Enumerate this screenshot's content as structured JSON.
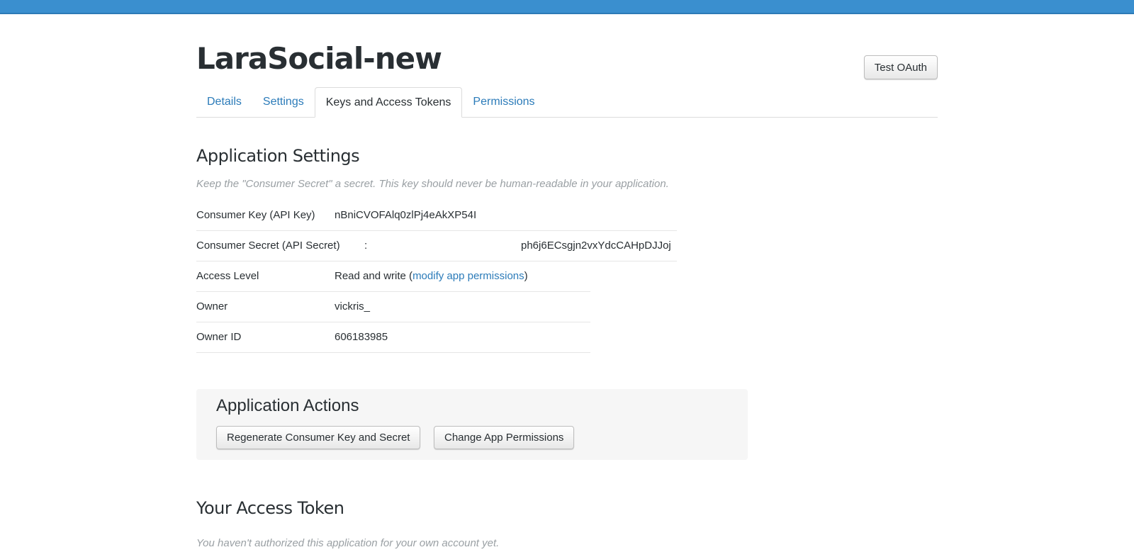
{
  "app": {
    "title": "LaraSocial-new",
    "test_oauth_label": "Test OAuth"
  },
  "tabs": [
    {
      "label": "Details",
      "active": false
    },
    {
      "label": "Settings",
      "active": false
    },
    {
      "label": "Keys and Access Tokens",
      "active": true
    },
    {
      "label": "Permissions",
      "active": false
    }
  ],
  "application_settings": {
    "title": "Application Settings",
    "note": "Keep the \"Consumer Secret\" a secret. This key should never be human-readable in your application.",
    "rows": {
      "consumer_key": {
        "label": "Consumer Key (API Key)",
        "value": "nBniCVOFAlq0zlPj4eAkXP54I"
      },
      "consumer_secret": {
        "label": "Consumer Secret (API Secret)",
        "value_start": ":",
        "value_end": "ph6j6ECsgjn2vxYdcCAHpDJJoj"
      },
      "access_level": {
        "label": "Access Level",
        "value_prefix": "Read and write (",
        "link": "modify app permissions",
        "value_suffix": ")"
      },
      "owner": {
        "label": "Owner",
        "value": "vickris_"
      },
      "owner_id": {
        "label": "Owner ID",
        "value": "606183985"
      }
    }
  },
  "application_actions": {
    "title": "Application Actions",
    "regenerate_label": "Regenerate Consumer Key and Secret",
    "change_permissions_label": "Change App Permissions"
  },
  "access_token": {
    "title": "Your Access Token",
    "note": "You haven't authorized this application for your own account yet."
  },
  "colors": {
    "topbar": "#3a8fcf",
    "link": "#2b7bb9",
    "text": "#292f33",
    "muted": "#9aa0a4"
  }
}
